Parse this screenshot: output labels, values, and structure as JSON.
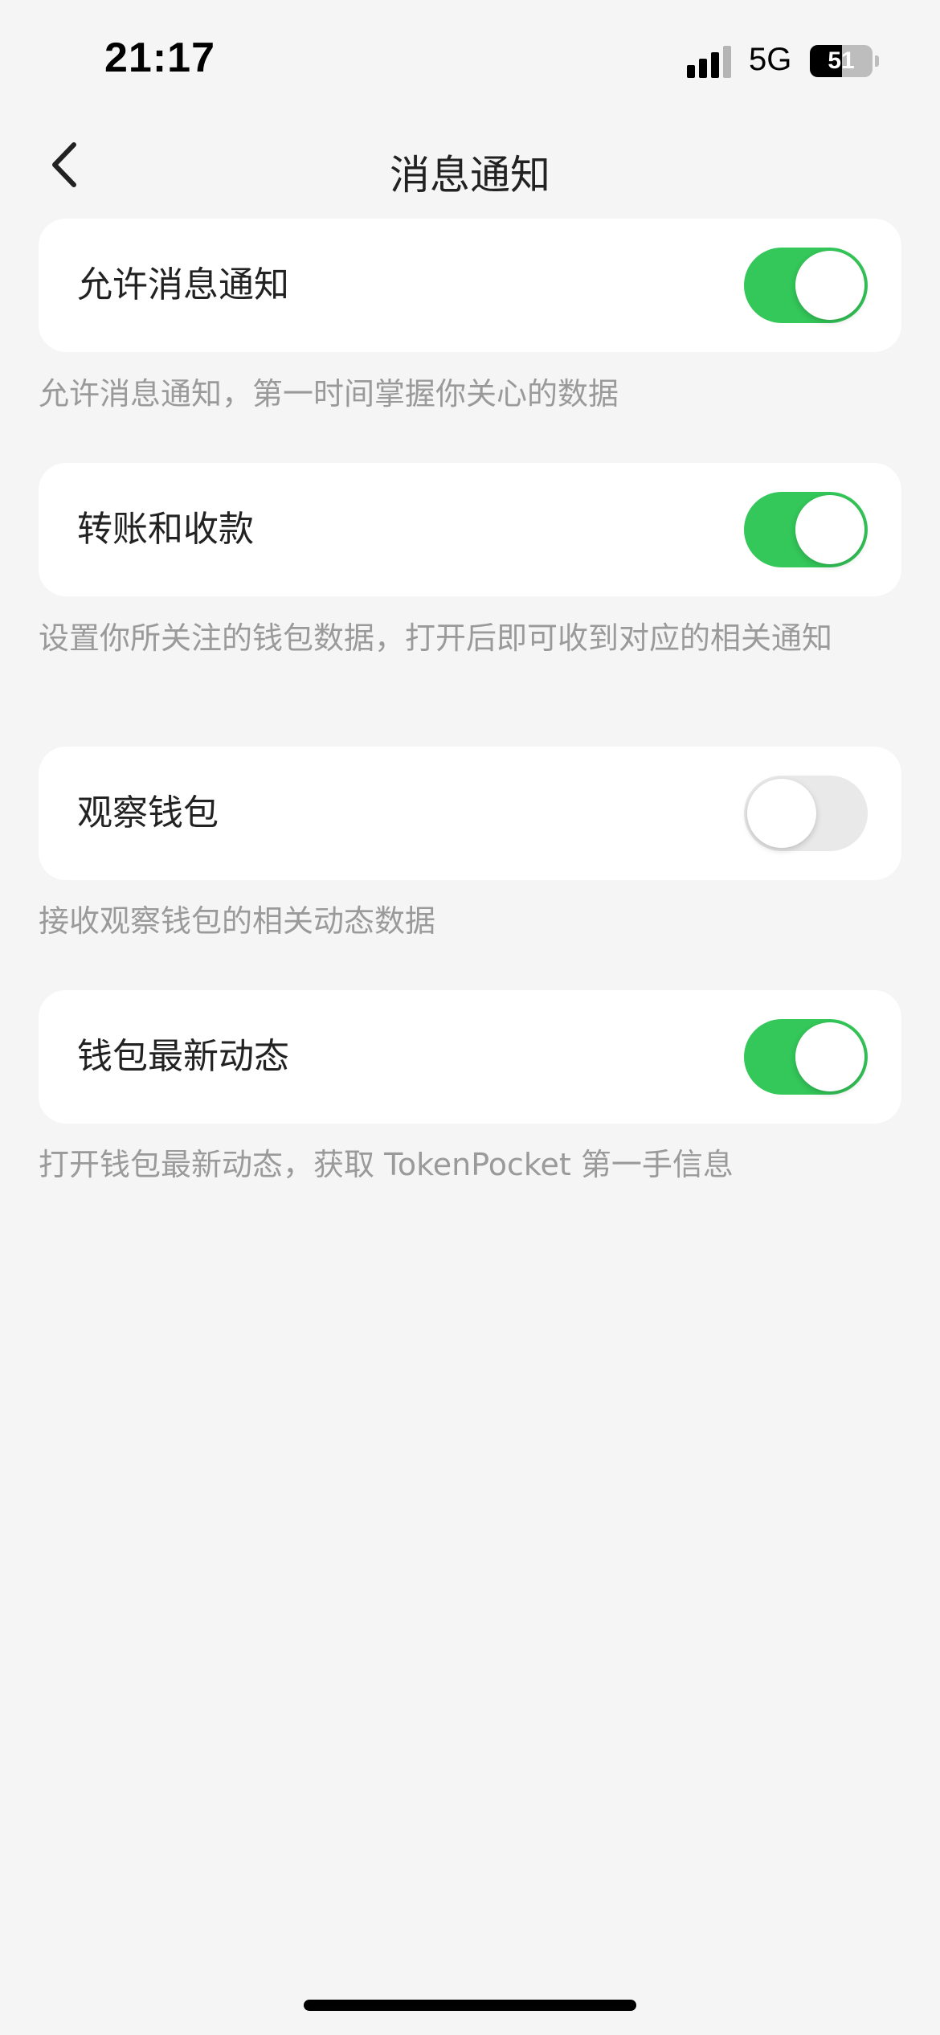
{
  "status_bar": {
    "time": "21:17",
    "network": "5G",
    "battery": "51",
    "battery_level": 0.51,
    "signal_icon": "signal-bars-icon",
    "battery_icon": "battery-icon"
  },
  "nav": {
    "title": "消息通知",
    "back_icon": "chevron-left-icon"
  },
  "settings": [
    {
      "label": "允许消息通知",
      "enabled": true,
      "description": "允许消息通知，第一时间掌握你关心的数据"
    },
    {
      "label": "转账和收款",
      "enabled": true,
      "description": "设置你所关注的钱包数据，打开后即可收到对应的相关通知"
    },
    {
      "label": "观察钱包",
      "enabled": false,
      "description": "接收观察钱包的相关动态数据"
    },
    {
      "label": "钱包最新动态",
      "enabled": true,
      "description": "打开钱包最新动态，获取 TokenPocket 第一手信息"
    }
  ],
  "colors": {
    "toggle_on": "#34c759",
    "toggle_off": "#e9e9ea",
    "background": "#f5f5f5"
  }
}
